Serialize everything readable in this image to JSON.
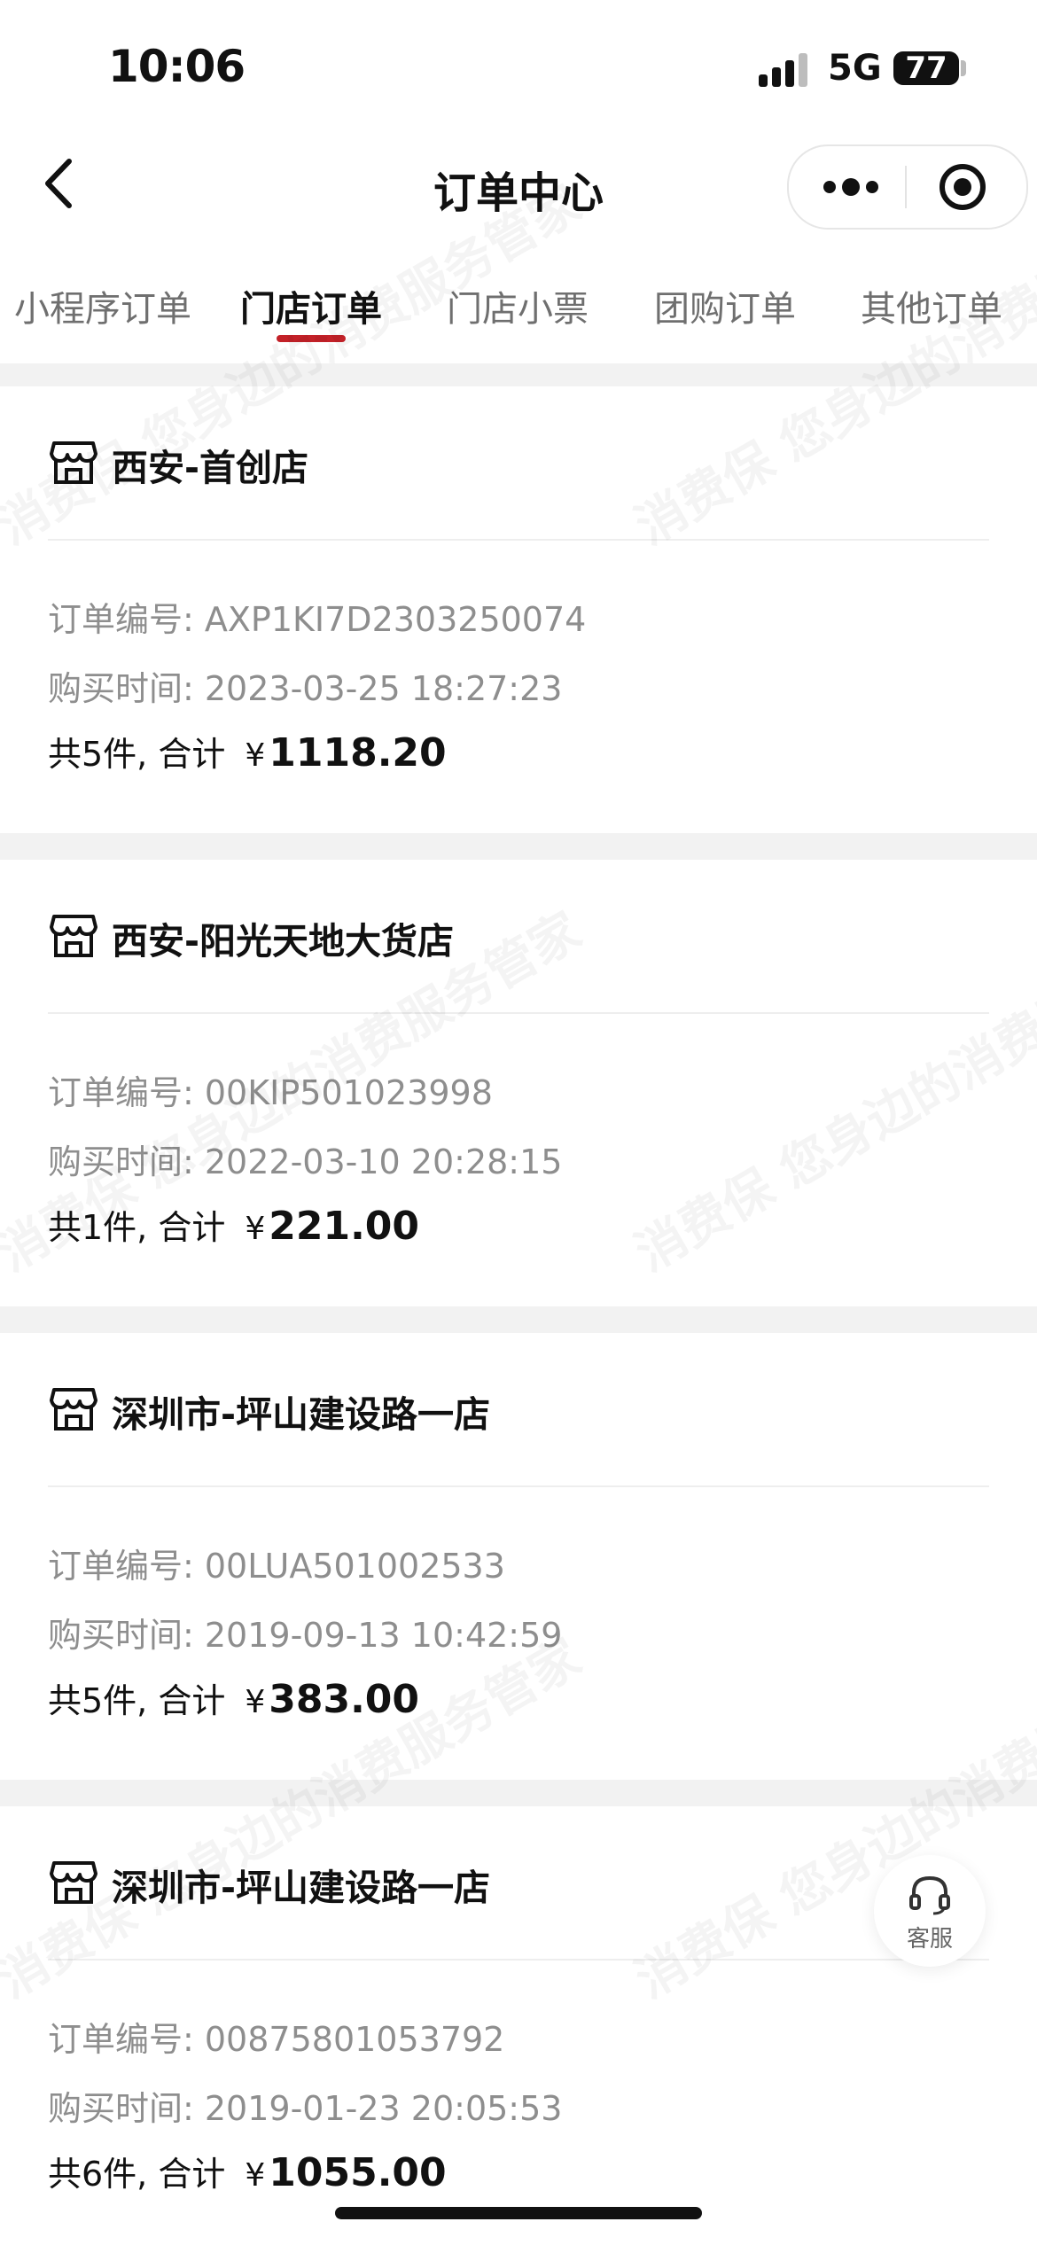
{
  "status_bar": {
    "time": "10:06",
    "network": "5G",
    "battery": "77"
  },
  "nav": {
    "title": "订单中心"
  },
  "tabs": [
    {
      "label": "小程序订单",
      "active": false
    },
    {
      "label": "门店订单",
      "active": true
    },
    {
      "label": "门店小票",
      "active": false
    },
    {
      "label": "团购订单",
      "active": false
    },
    {
      "label": "其他订单",
      "active": false
    }
  ],
  "orders": [
    {
      "store": "西安-首创店",
      "order_no": "订单编号: AXP1KI7D2303250074",
      "purchase_time": "购买时间: 2023-03-25 18:27:23",
      "count_text": "共5件, 合计",
      "currency": "¥",
      "amount": "1118.20"
    },
    {
      "store": "西安-阳光天地大货店",
      "order_no": "订单编号: 00KIP501023998",
      "purchase_time": "购买时间: 2022-03-10 20:28:15",
      "count_text": "共1件, 合计",
      "currency": "¥",
      "amount": "221.00"
    },
    {
      "store": "深圳市-坪山建设路一店",
      "order_no": "订单编号: 00LUA501002533",
      "purchase_time": "购买时间: 2019-09-13 10:42:59",
      "count_text": "共5件, 合计",
      "currency": "¥",
      "amount": "383.00"
    },
    {
      "store": "深圳市-坪山建设路一店",
      "order_no": "订单编号: 00875801053792",
      "purchase_time": "购买时间: 2019-01-23 20:05:53",
      "count_text": "共6件, 合计",
      "currency": "¥",
      "amount": "1055.00"
    }
  ],
  "customer_service": {
    "label": "客服"
  },
  "watermark": {
    "text": "消费保 您身边的消费服务管家"
  },
  "colors": {
    "accent": "#c32128",
    "text_secondary": "#8e8e8e",
    "background": "#f2f2f2"
  }
}
